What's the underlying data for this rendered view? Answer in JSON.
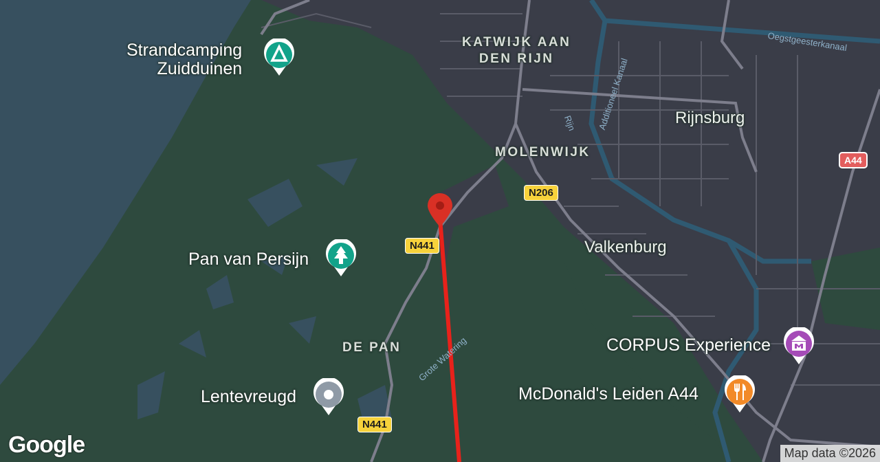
{
  "map": {
    "colors": {
      "sea": "#37505f",
      "land": "#2e4a3e",
      "urban": "#3a3d48",
      "road": "#6b6c7a",
      "major_road": "#8a8a98",
      "river": "#2f5a72",
      "route": "#e8221b"
    },
    "places": {
      "katwijk": "KATWIJK AAN\nDEN RIJN",
      "molenwijk": "MOLENWIJK",
      "rijnsburg": "Rijnsburg",
      "valkenburg": "Valkenburg",
      "depan": "DE PAN"
    },
    "water": {
      "oegstgeesterkanaal": "Oegstgeesterkanaal",
      "additioneel": "Additioneel Kanaal",
      "rijn": "Rijn",
      "grote_watering": "Grote Watering"
    },
    "roads": {
      "n441_a": "N441",
      "n441_b": "N441",
      "n206": "N206",
      "a44": "A44"
    },
    "pois": {
      "strandcamping": {
        "label": "Strandcamping\nZuidduinen",
        "icon": "campground-icon",
        "color": "#12a38a"
      },
      "pan": {
        "label": "Pan van Persijn",
        "icon": "tree-icon",
        "color": "#12a38a"
      },
      "lentevreugd": {
        "label": "Lentevreugd",
        "icon": "dot-icon",
        "color": "#8f9aa6"
      },
      "corpus": {
        "label": "CORPUS Experience",
        "icon": "museum-icon",
        "color": "#a54bb7"
      },
      "mcdonalds": {
        "label": "McDonald's Leiden A44",
        "icon": "restaurant-icon",
        "color": "#f28a28"
      }
    },
    "marker": {
      "icon": "location-pin-icon",
      "color": "#d93025"
    },
    "logo": "Google",
    "attribution": "Map data ©2026"
  }
}
